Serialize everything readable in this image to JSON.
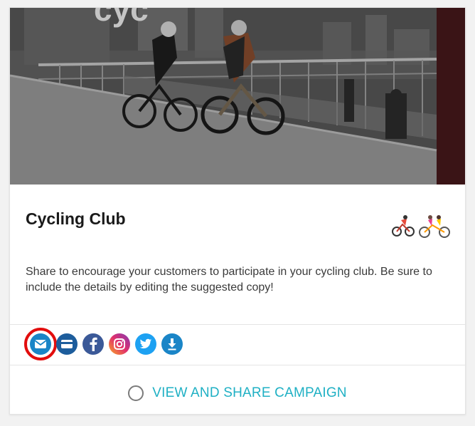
{
  "campaign": {
    "title": "Cycling Club",
    "description": "Share to encourage your customers to participate in your cycling club. Be sure to include the details by editing the suggested copy!",
    "emojis": [
      "cyclist-emoji",
      "tandem-bicycle-emoji"
    ]
  },
  "share": {
    "buttons": [
      {
        "name": "email-icon",
        "color": "#1a85c7",
        "highlighted": true
      },
      {
        "name": "card-icon",
        "color": "#1d5d9c"
      },
      {
        "name": "facebook-icon",
        "color": "#3b5998"
      },
      {
        "name": "instagram-icon",
        "color": "#c13584"
      },
      {
        "name": "twitter-icon",
        "color": "#1da1f2"
      },
      {
        "name": "download-icon",
        "color": "#1a85c7"
      }
    ]
  },
  "cta": {
    "label": "VIEW AND SHARE CAMPAIGN",
    "color": "#1fb0c4"
  },
  "colors": {
    "highlight_ring": "#e20d0d"
  }
}
